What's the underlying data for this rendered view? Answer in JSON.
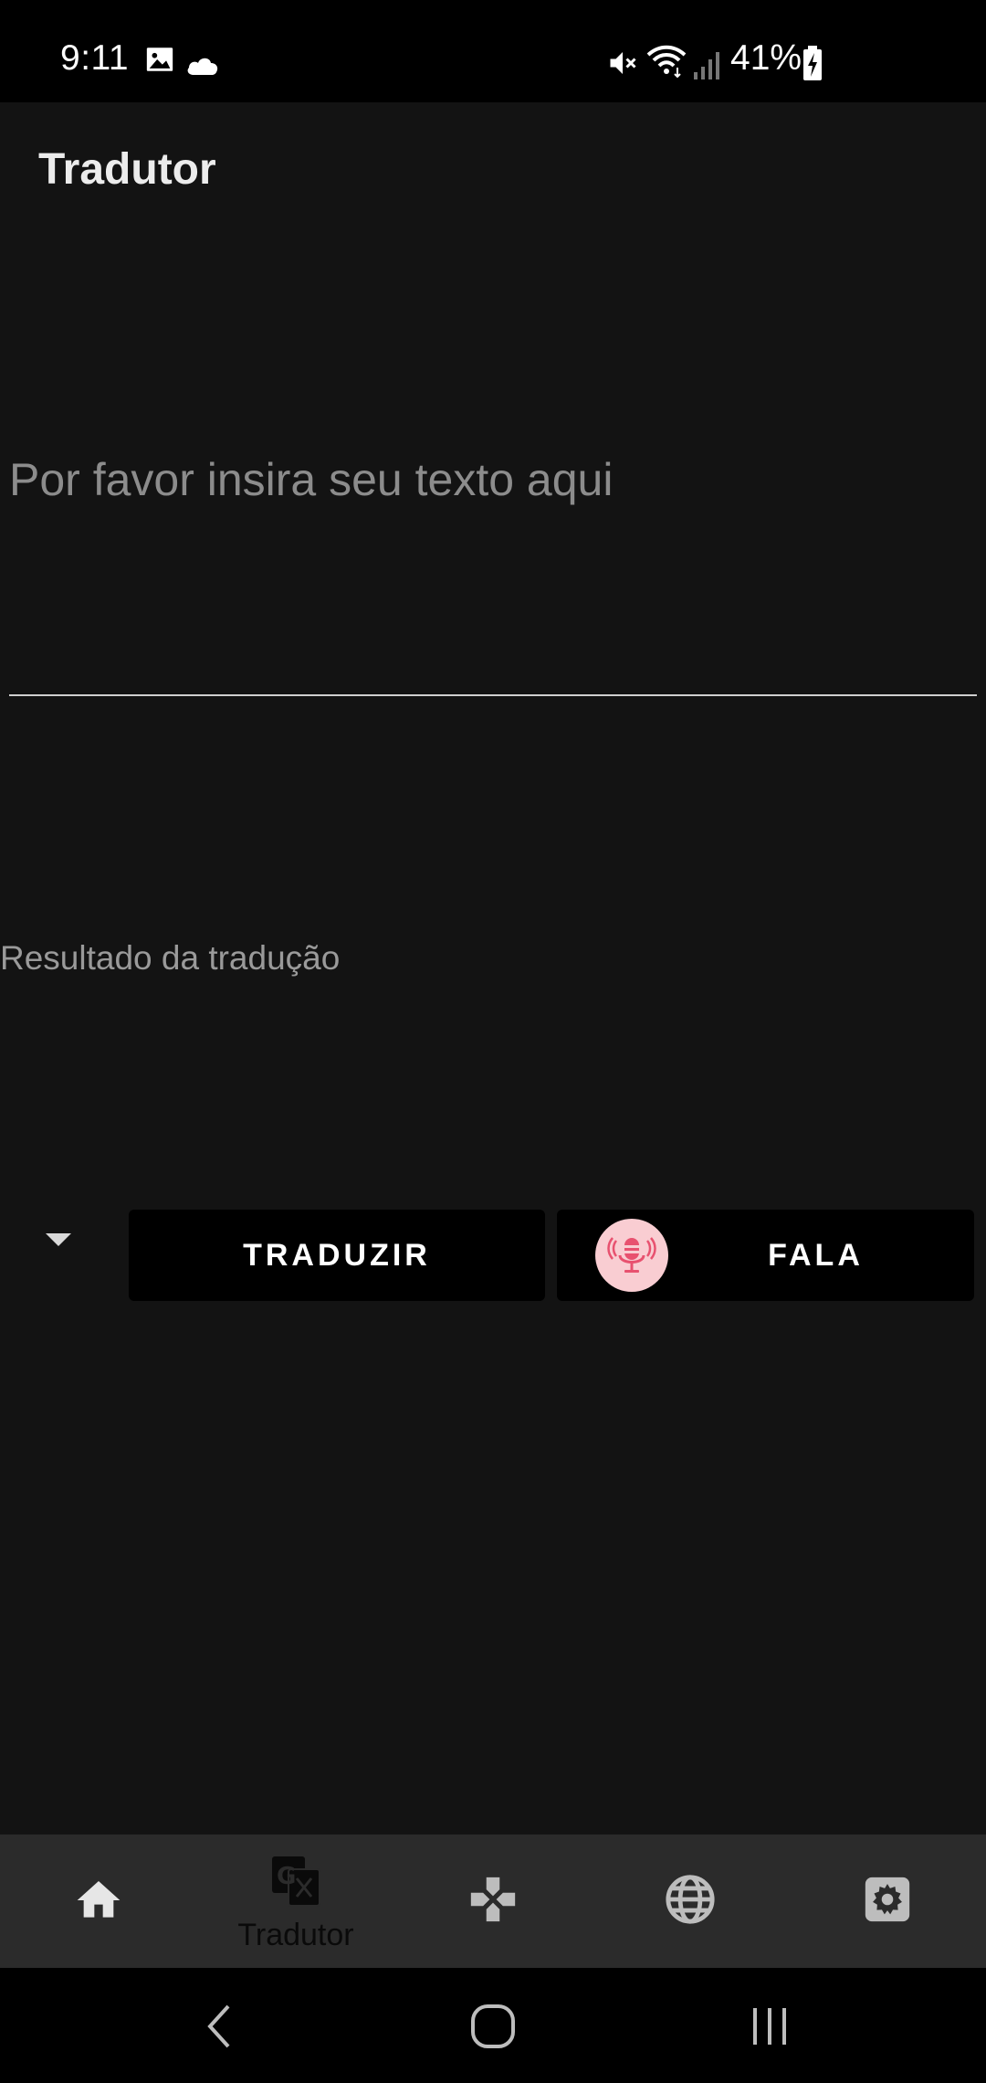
{
  "status_bar": {
    "time": "9:11",
    "battery": "41%",
    "icons": [
      "image-icon",
      "cloud-icon",
      "vibrate-off-icon",
      "wifi-icon",
      "signal-icon",
      "battery-charging-icon"
    ]
  },
  "app_bar": {
    "title": "Tradutor"
  },
  "input": {
    "placeholder": "Por favor insira seu texto aqui",
    "value": ""
  },
  "result": {
    "label": "Resultado da tradução"
  },
  "controls": {
    "dropdown_icon": "caret-down-icon",
    "translate_label": "TRADUZIR",
    "speak_label": "FALA",
    "mic_icon": "microphone-icon"
  },
  "bottom_nav": {
    "items": [
      {
        "icon": "home-icon",
        "label": ""
      },
      {
        "icon": "translate-icon",
        "label": "Tradutor"
      },
      {
        "icon": "gamepad-icon",
        "label": ""
      },
      {
        "icon": "globe-icon",
        "label": ""
      },
      {
        "icon": "settings-icon",
        "label": ""
      }
    ],
    "active_index": 1
  },
  "system_nav": {
    "buttons": [
      "back-icon",
      "home-circle-icon",
      "recents-icon"
    ]
  },
  "colors": {
    "background": "#131313",
    "status_bar": "#000000",
    "button_bg": "#000000",
    "nav_bg": "#2b2b2b",
    "mic_accent": "#e8516f",
    "mic_bg": "#f9cdd2",
    "placeholder": "#8c8c8c"
  }
}
